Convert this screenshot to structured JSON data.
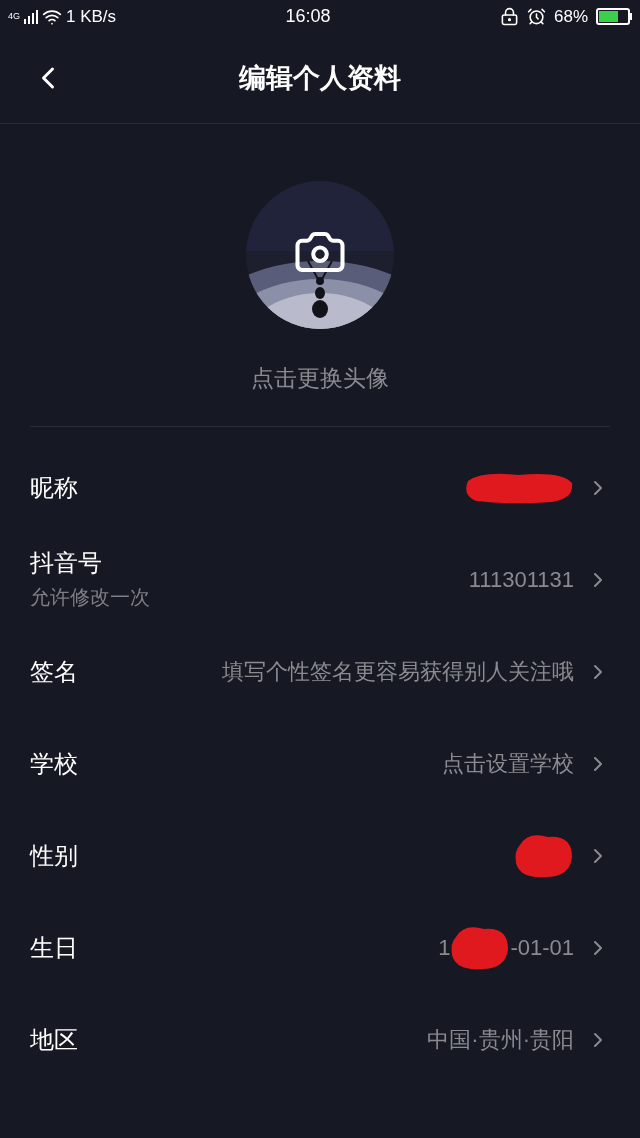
{
  "status_bar": {
    "network": "4G",
    "speed": "1 KB/s",
    "time": "16:08",
    "battery": "68%",
    "charging": true
  },
  "header": {
    "title": "编辑个人资料"
  },
  "avatar": {
    "kind": "picture",
    "caption": "点击更换头像"
  },
  "rows": [
    {
      "label": "昵称",
      "redacted": true
    },
    {
      "label": "抖音号",
      "sublabel": "允许修改一次",
      "value": "111301131",
      "redacted": false
    },
    {
      "label": "签名",
      "value": "填写个性签名更容易获得别人关注哦",
      "redacted": false
    },
    {
      "label": "学校",
      "value": "点击设置学校",
      "redacted": false
    },
    {
      "label": "性别",
      "redacted": true
    },
    {
      "label": "生日",
      "value": "1",
      "value_suffix": "-01-01",
      "redacted": true
    },
    {
      "label": "地区",
      "value": "中国·贵州·贵阳",
      "redacted": false
    }
  ]
}
